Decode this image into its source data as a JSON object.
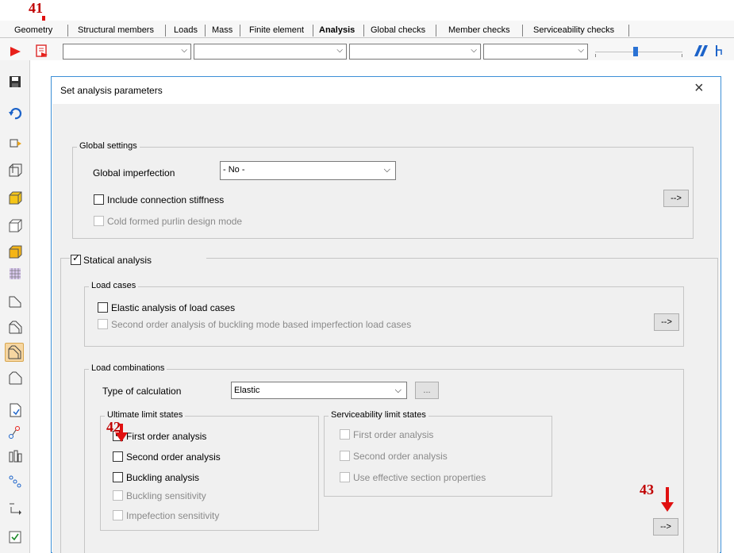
{
  "tabs": [
    "Geometry",
    "Structural members",
    "Loads",
    "Mass",
    "Finite element",
    "Analysis",
    "Global checks",
    "Member checks",
    "Serviceability checks"
  ],
  "active_tab": "Analysis",
  "annotations": {
    "a41": "41",
    "a42": "42",
    "a43": "43"
  },
  "dialog": {
    "title": "Set analysis parameters",
    "close_glyph": "×",
    "global_settings": {
      "title": "Global settings",
      "imperfection_label": "Global imperfection",
      "imperfection_value": "- No -",
      "connection_stiffness_label": "Include connection stiffness",
      "connection_stiffness_checked": false,
      "cold_formed_label": "Cold formed purlin design mode",
      "cold_formed_checked": false,
      "more_button": "-->"
    },
    "statical_analysis": {
      "label": "Statical analysis",
      "checked": true,
      "load_cases": {
        "title": "Load cases",
        "elastic_label": "Elastic analysis of load cases",
        "elastic_checked": false,
        "second_order_label": "Second order analysis of buckling mode based imperfection load cases",
        "second_order_checked": false,
        "more_button": "-->"
      },
      "load_combinations": {
        "title": "Load combinations",
        "type_label": "Type of calculation",
        "type_value": "Elastic",
        "ellipsis_button": "...",
        "uls": {
          "title": "Ultimate limit states",
          "items": [
            {
              "label": "First order analysis",
              "checked": true,
              "disabled": false
            },
            {
              "label": "Second order analysis",
              "checked": false,
              "disabled": false
            },
            {
              "label": "Buckling analysis",
              "checked": false,
              "disabled": false
            },
            {
              "label": "Buckling sensitivity",
              "checked": false,
              "disabled": true
            },
            {
              "label": "Impefection sensitivity",
              "checked": false,
              "disabled": true
            }
          ]
        },
        "sls": {
          "title": "Serviceability limit states",
          "items": [
            {
              "label": "First order analysis",
              "checked": false,
              "disabled": true
            },
            {
              "label": "Second order analysis",
              "checked": false,
              "disabled": true
            },
            {
              "label": "Use effective section properties",
              "checked": false,
              "disabled": true
            }
          ]
        },
        "more_button": "-->"
      }
    }
  },
  "check_glyph": "✓",
  "dropdown_glyph": "⌵",
  "colors": {
    "accent": "#3c8fd6",
    "annotation": "#e01010",
    "run_icon": "#e8201a"
  }
}
